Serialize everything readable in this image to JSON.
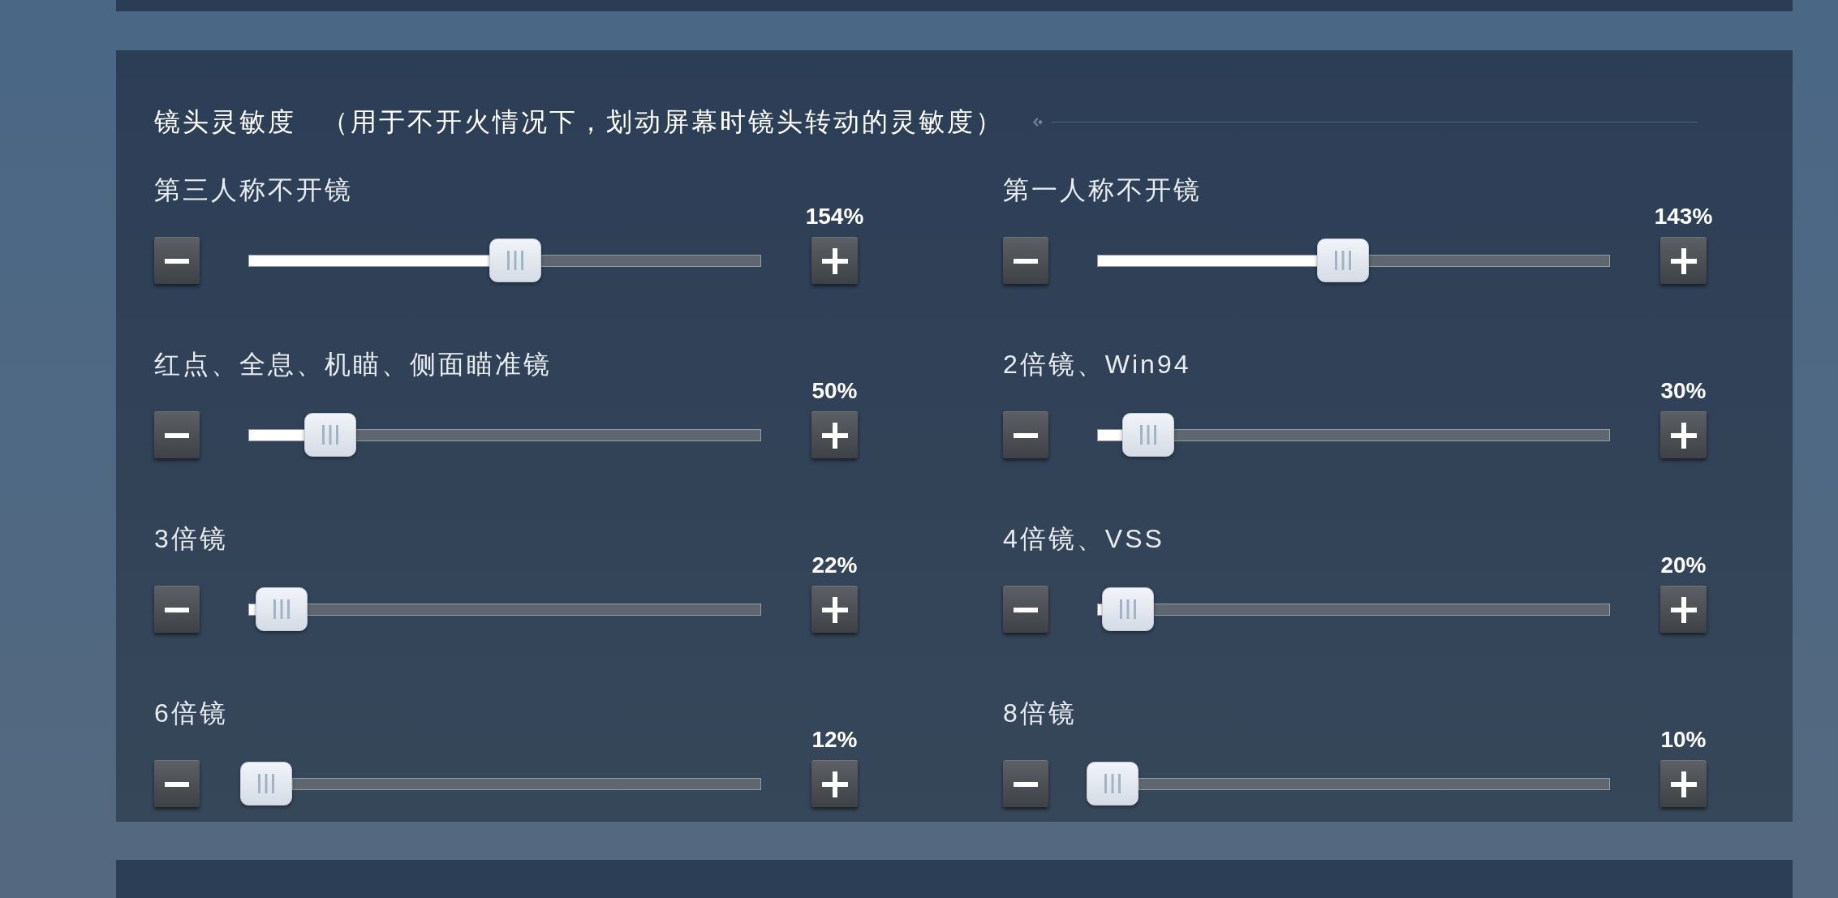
{
  "section": {
    "title": "镜头灵敏度",
    "note": "（用于不开火情况下，划动屏幕时镜头转动的灵敏度）"
  },
  "sliders": [
    {
      "label": "第三人称不开镜",
      "reading": "154%",
      "level": 0.52
    },
    {
      "label": "第一人称不开镜",
      "reading": "143%",
      "level": 0.48
    },
    {
      "label": "红点、全息、机瞄、侧面瞄准镜",
      "reading": "50%",
      "level": 0.16
    },
    {
      "label": "2倍镜、Win94",
      "reading": "30%",
      "level": 0.1
    },
    {
      "label": "3倍镜",
      "reading": "22%",
      "level": 0.065
    },
    {
      "label": "4倍镜、VSS",
      "reading": "20%",
      "level": 0.06
    },
    {
      "label": "6倍镜",
      "reading": "12%",
      "level": 0.035
    },
    {
      "label": "8倍镜",
      "reading": "10%",
      "level": 0.03
    }
  ]
}
